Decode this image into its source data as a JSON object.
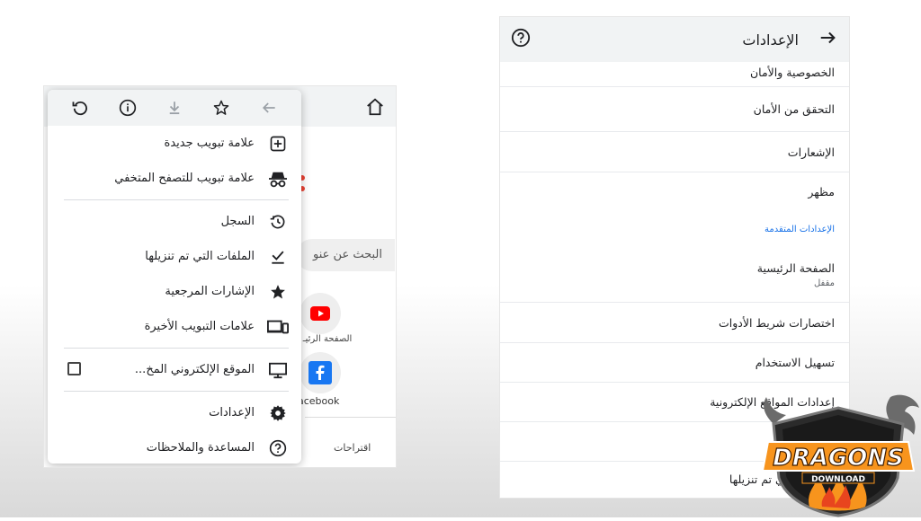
{
  "left_panel": {
    "background": {
      "search_text": "البحث عن عنو",
      "youtube_label": "الصفحة الرئيـ",
      "facebook_label": "acebook",
      "suggestions_label": "اقتراحات"
    },
    "toolbar": {
      "icons": [
        "back-arrow-icon",
        "star-icon",
        "download-icon",
        "info-icon",
        "refresh-icon"
      ]
    },
    "menu_items": [
      {
        "label": "علامة تبويب جديدة",
        "icon": "new-tab-icon"
      },
      {
        "label": "علامة تبويب للتصفح المتخفي",
        "icon": "incognito-icon"
      },
      {
        "label": "السجل",
        "icon": "history-icon"
      },
      {
        "label": "الملفات التي تم تنزيلها",
        "icon": "downloads-check-icon"
      },
      {
        "label": "الإشارات المرجعية",
        "icon": "star-filled-icon"
      },
      {
        "label": "علامات التبويب الأخيرة",
        "icon": "devices-icon"
      },
      {
        "label": "الموقع الإلكتروني المخ...",
        "icon": "desktop-icon"
      },
      {
        "label": "الإعدادات",
        "icon": "gear-icon"
      },
      {
        "label": "المساعدة والملاحظات",
        "icon": "help-icon"
      }
    ]
  },
  "right_panel": {
    "header": {
      "title": "الإعدادات"
    },
    "rows": [
      {
        "label": "الخصوصية والأمان"
      },
      {
        "label": "التحقق من الأمان"
      },
      {
        "label": "الإشعارات"
      },
      {
        "label": "مظهر"
      }
    ],
    "section_label": "الإعدادات المتقدمة",
    "rows_advanced": [
      {
        "label": "الصفحة الرئيسية",
        "sub": "مقفل"
      },
      {
        "label": "اختصارات شريط الأدوات"
      },
      {
        "label": "تسهيل الاستخدام"
      },
      {
        "label": "إعدادات المواقع الإلكترونية"
      },
      {
        "label": ""
      },
      {
        "label": "الملفات التي تم تنزيلها"
      }
    ]
  },
  "logo": {
    "line1": "DRAGONS",
    "line2": "DOWNLOAD"
  },
  "colors": {
    "accent": "#1a73e8",
    "youtube": "#ff0000",
    "facebook": "#1877f2",
    "logo_orange": "#f7941d"
  }
}
